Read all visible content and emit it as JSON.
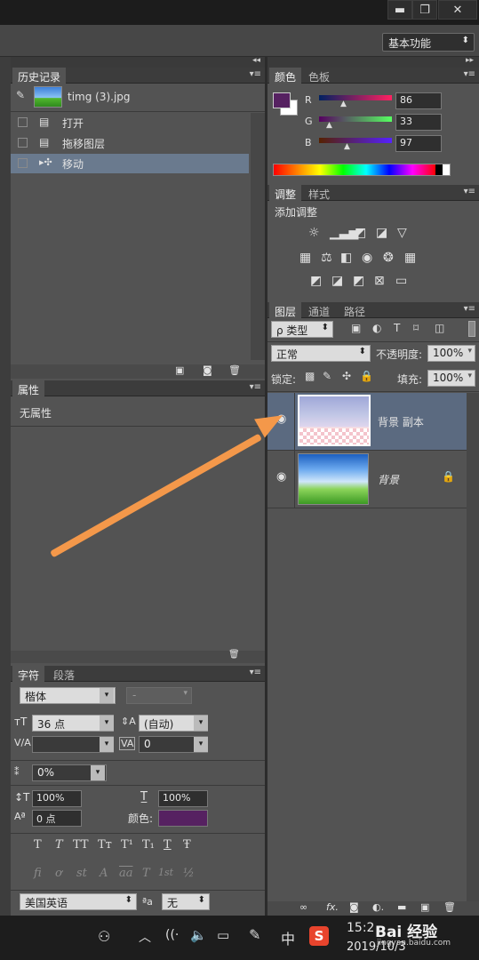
{
  "window": {
    "minimize": "▬",
    "restore": "❐",
    "close": "✕"
  },
  "workspace": {
    "label": "基本功能"
  },
  "history": {
    "tab": "历史记录",
    "snapshot": "timg (3).jpg",
    "items": [
      {
        "label": "打开"
      },
      {
        "label": "拖移图层"
      },
      {
        "label": "移动"
      }
    ]
  },
  "properties": {
    "tab": "属性",
    "empty": "无属性"
  },
  "color": {
    "tabs": [
      "颜色",
      "色板"
    ],
    "r_label": "R",
    "g_label": "G",
    "b_label": "B",
    "r": "86",
    "g": "33",
    "b": "97",
    "foreground": "#562161"
  },
  "adjustments": {
    "tabs": [
      "调整",
      "样式"
    ],
    "title": "添加调整"
  },
  "layers": {
    "tabs": [
      "图层",
      "通道",
      "路径"
    ],
    "filter": "ρ 类型",
    "blend": "正常",
    "opacity_label": "不透明度:",
    "opacity": "100%",
    "lock_label": "锁定:",
    "fill_label": "填充:",
    "fill": "100%",
    "items": [
      {
        "name": "背景 副本",
        "selected": true
      },
      {
        "name": "背景",
        "locked": true
      }
    ]
  },
  "character": {
    "tabs": [
      "字符",
      "段落"
    ],
    "font": "楷体",
    "style": "-",
    "size": "36 点",
    "leading": "(自动)",
    "kerning": "",
    "tracking": "0",
    "scale_percent": "0%",
    "vscale": "100%",
    "hscale": "100%",
    "baseline": "0 点",
    "color_label": "颜色:",
    "color": "#562161",
    "language": "美国英语",
    "aa_label": "ªa",
    "antialias": "无",
    "style_buttons": [
      "T",
      "T",
      "TT",
      "Tт",
      "T¹",
      "T₁",
      "T",
      "Ŧ"
    ],
    "ot_buttons": [
      "fi",
      "ơ",
      "st",
      "A",
      "aa",
      "T",
      "1st",
      "½"
    ]
  },
  "taskbar": {
    "ime": "中",
    "time": "15:2",
    "date": "2019/10/3",
    "watermark": "Bai 经验",
    "watermark_sub": "jingyan.baidu.com"
  }
}
